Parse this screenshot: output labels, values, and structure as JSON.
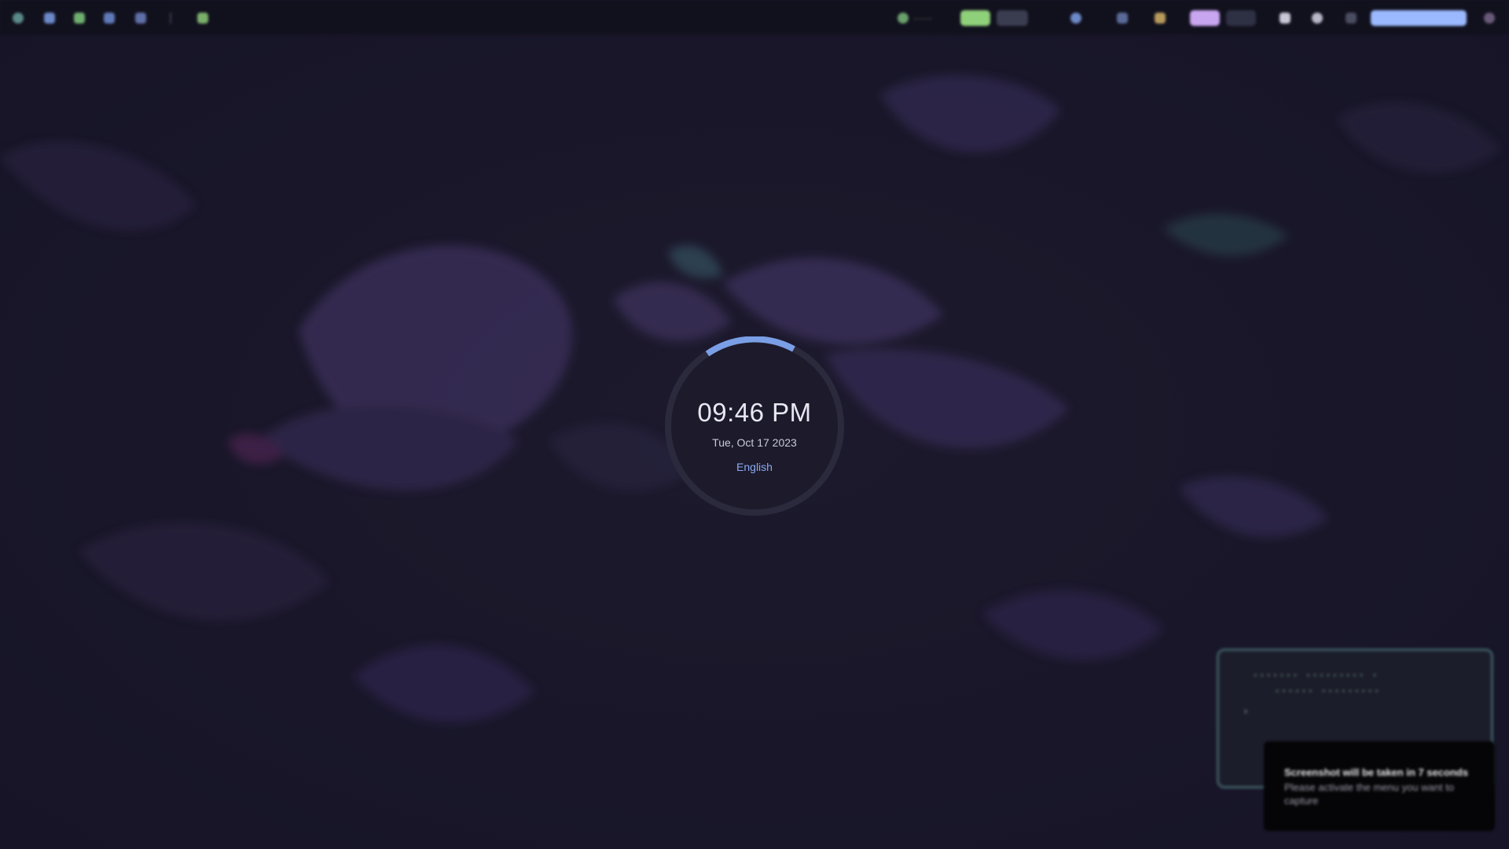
{
  "clock": {
    "time": "09:46 PM",
    "date": "Tue, Oct 17 2023",
    "language": "English",
    "accent_color": "#7a9fe6"
  },
  "topbar": {
    "left_icons": [
      "arch-logo-icon",
      "folder-icon",
      "shield-icon",
      "mail-icon",
      "chat-icon",
      "separator-icon",
      "image-icon"
    ],
    "right_icons": [
      "update-icon",
      "workspace-icon",
      "cpu-icon",
      "mic-icon",
      "battery-icon",
      "search-icon",
      "window-icon",
      "bell-icon",
      "power-icon",
      "network-icon",
      "wifi-icon",
      "clock-icon",
      "avatar-icon"
    ],
    "accent_colors": {
      "workspace": "#8fd07a",
      "search": "#c9a6f0",
      "clock_pill": "#9bb9ff"
    }
  },
  "notification": {
    "title": "Screenshot will be taken in 7 seconds",
    "body": "Please activate the menu you want to capture"
  },
  "wallpaper": {
    "palette": [
      "#1e1b2e",
      "#2d2644",
      "#3d3360",
      "#4a3b70",
      "#2f4a55"
    ]
  }
}
